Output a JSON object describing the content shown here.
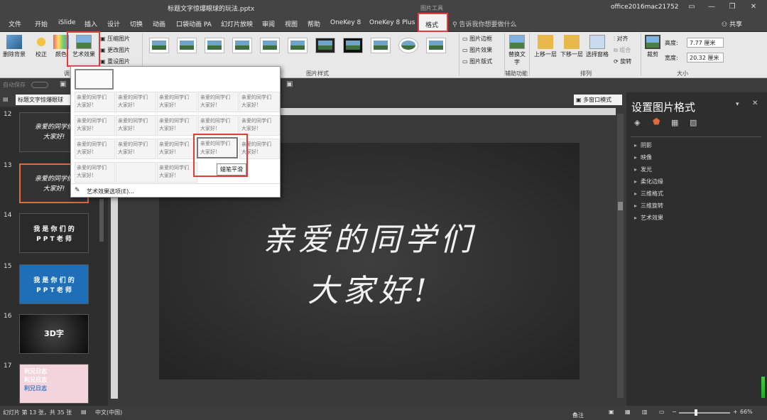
{
  "title_bar": {
    "doc_title": "标题文字惊爆眼球的玩法.pptx",
    "context_tab_group": "图片工具",
    "user": "office2016mac21752",
    "buttons": [
      "▭",
      "—",
      "❐",
      "✕"
    ]
  },
  "menu": {
    "tabs": [
      "文件",
      "开始",
      "iSlide",
      "插入",
      "设计",
      "切换",
      "动画",
      "口袋动画 PA",
      "幻灯片放映",
      "审阅",
      "视图",
      "帮助",
      "OneKey 8",
      "OneKey 8 Plus"
    ],
    "active_tab": "格式",
    "tell_me": "告诉我你想要做什么",
    "share": "共享"
  },
  "ribbon": {
    "adjust_group": {
      "remove_bg": "删除背景",
      "correct": "校正",
      "color": "颜色",
      "artistic": "艺术效果",
      "compress": "压缩图片",
      "change": "更改图片",
      "reset": "重设图片",
      "label": "调"
    },
    "styles_group": {
      "label": "图片样式",
      "count": 11
    },
    "style_options": [
      "图片边框",
      "图片效果",
      "图片版式"
    ],
    "accessibility": {
      "alt_text": "替换文字",
      "label": "辅助功能"
    },
    "arrange": {
      "bring_forward": "上移一层",
      "send_backward": "下移一层",
      "selection_pane": "选择窗格",
      "align": "对齐",
      "group": "组合",
      "rotate": "旋转",
      "label": "排列"
    },
    "size": {
      "crop": "裁剪",
      "height_label": "高度:",
      "height_value": "7.77 厘米",
      "width_label": "宽度:",
      "width_value": "20.32 厘米",
      "label": "大小"
    }
  },
  "qat": {
    "autosave": "自动保存"
  },
  "toolbar2": {
    "doc_tab": "标题文字惊爆眼球",
    "multi_window": "多窗口模式"
  },
  "thumbnails": [
    {
      "num": "12",
      "lines": [
        "亲爱的同学们",
        "大家好!"
      ],
      "bg": "#333333"
    },
    {
      "num": "13",
      "lines": [
        "亲爱的同学们",
        "大家好!"
      ],
      "bg": "#333333",
      "selected": true
    },
    {
      "num": "14",
      "lines": [
        "我 是 你 们 的",
        "P P T 老 师"
      ],
      "bg": "#2a2a2a"
    },
    {
      "num": "15",
      "lines": [
        "我 是 你 们 的",
        "P P T 老 师"
      ],
      "bg": "#1e6fb8"
    },
    {
      "num": "16",
      "lines": [
        "3D字"
      ],
      "bg": "#111111"
    },
    {
      "num": "17",
      "lines": [
        "利兄日志",
        "利兄日志",
        "利兄日志"
      ],
      "bg": "#f4d4dc"
    }
  ],
  "slide": {
    "line1": "亲爱的同学们",
    "line2": "大家好!"
  },
  "artistic_gallery": {
    "effect_text": [
      "亲爱的同学们",
      "大家好!"
    ],
    "hover_tooltip": "蜡笔平滑",
    "options_link": "艺术效果选项(E)..."
  },
  "format_pane": {
    "title": "设置图片格式",
    "sections": [
      "阴影",
      "映像",
      "发光",
      "柔化边缘",
      "三维格式",
      "三维旋转",
      "艺术效果"
    ]
  },
  "status": {
    "slide_info": "幻灯片 第 13 张，共 35 张",
    "language": "中文(中国)",
    "notes": "备注",
    "zoom": "66%",
    "zoom_level": 0.66
  },
  "colors": {
    "accent_red": "#e03c3c",
    "title_bg": "#444444",
    "ribbon_bg": "#e8e8e8",
    "pane_bg": "#2e2e2e"
  }
}
